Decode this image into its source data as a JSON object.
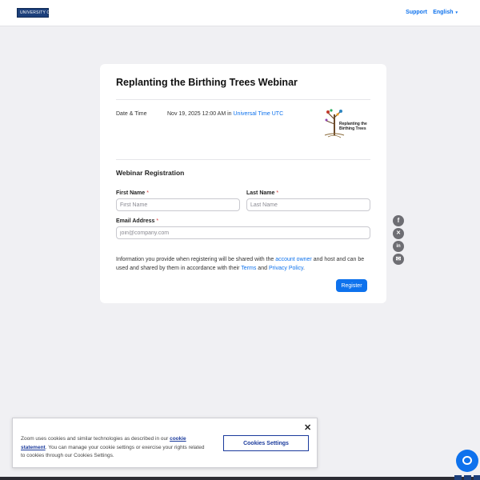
{
  "header": {
    "logo_text": "UNIVERSITY OF AUCKLAND",
    "support_label": "Support",
    "language_label": "English",
    "language_chevron": "▾"
  },
  "event": {
    "title": "Replanting the Birthing Trees Webinar",
    "date_time_label": "Date & Time",
    "date_time_value": "Nov 19, 2025 12:00 AM in ",
    "timezone": "Universal Time UTC",
    "image_text_1": "Replanting the",
    "image_text_2": "Birthing Trees"
  },
  "registration": {
    "section_title": "Webinar Registration",
    "first_name_label": "First Name",
    "first_name_placeholder": "First Name",
    "last_name_label": "Last Name",
    "last_name_placeholder": "Last Name",
    "email_label": "Email Address",
    "email_placeholder": "join@company.com",
    "required_mark": "*",
    "info_part1": "Information you provide when registering will be shared with the ",
    "info_link_account_owner": "account owner",
    "info_part2": " and host and can be used and shared by them in accordance with their ",
    "info_link_terms": "Terms",
    "info_part3": " and ",
    "info_link_privacy": "Privacy Policy",
    "info_part4": ".",
    "register_label": "Register"
  },
  "share": {
    "facebook_glyph": "f",
    "x_glyph": "✕",
    "linkedin_glyph": "in",
    "email_glyph": "✉"
  },
  "cookie_banner": {
    "text_part1": "Zoom uses cookies and similar technologies as described in our ",
    "link_label": "cookie statement",
    "text_part2": ". You can manage your cookie settings or exercise your rights related to cookies through our Cookies Settings.",
    "settings_label": "Cookies Settings",
    "close_glyph": "✕"
  },
  "colors": {
    "accent": "#0e72ed",
    "brand_navy": "#1c3f7a",
    "page_bg": "#f0f0f3"
  }
}
